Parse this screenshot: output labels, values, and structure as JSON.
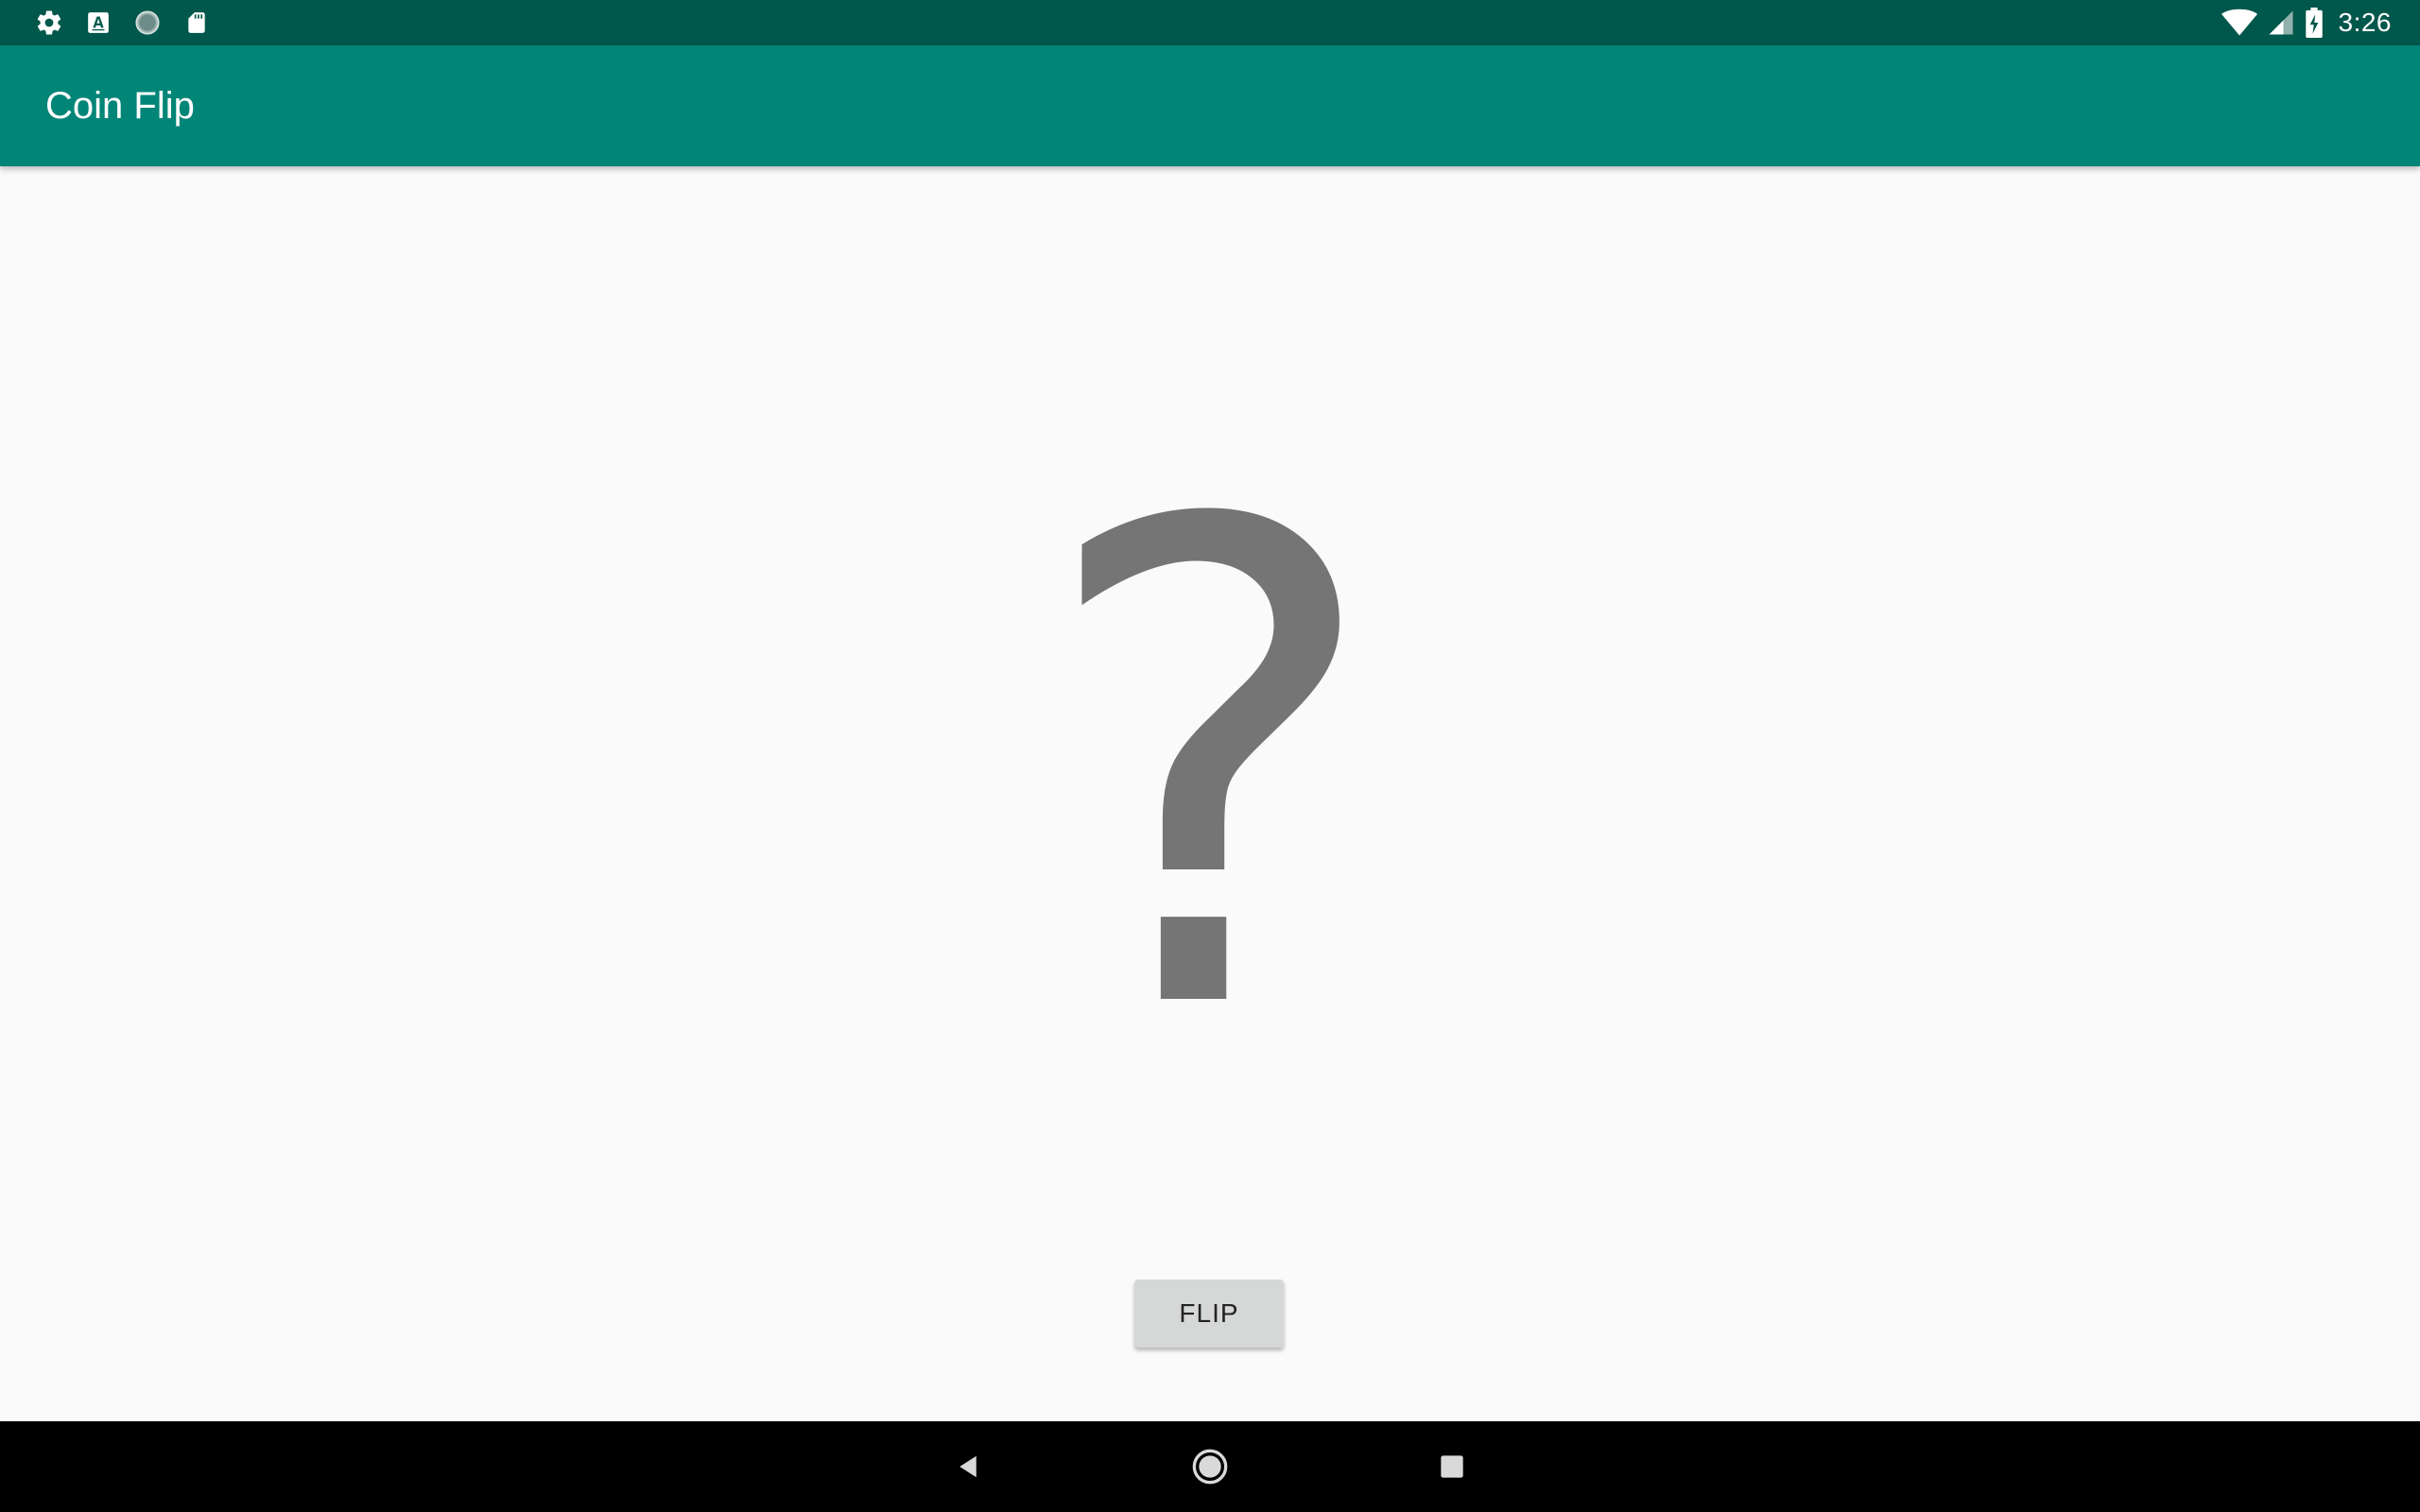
{
  "status_bar": {
    "left_icons": [
      "gear-icon",
      "font-a-icon",
      "sync-circle-icon",
      "sd-card-icon"
    ],
    "right_icons": [
      "wifi-icon",
      "signal-icon",
      "battery-charging-icon"
    ],
    "time": "3:26"
  },
  "app_bar": {
    "title": "Coin Flip"
  },
  "main": {
    "result_symbol": "?",
    "flip_label": "FLIP"
  },
  "nav_bar": {
    "buttons": [
      "back-icon",
      "home-icon",
      "recents-icon"
    ]
  },
  "colors": {
    "status_bar": "#00574b",
    "app_bar": "#008577",
    "background": "#fafafa",
    "result_symbol": "#757575",
    "button": "#d6d7d7",
    "nav_bar": "#000000"
  }
}
